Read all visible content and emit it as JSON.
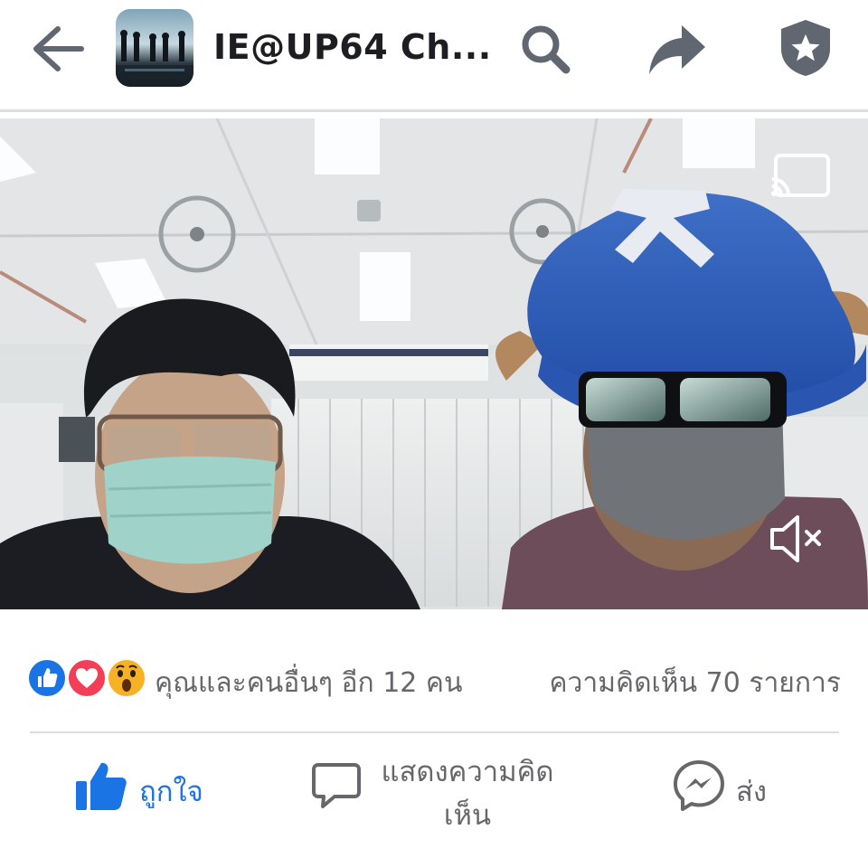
{
  "header": {
    "title": "IE@UP64 Ch...",
    "back_icon": "arrow-left-icon",
    "search_icon": "search-icon",
    "share_icon": "share-arrow-icon",
    "shield_icon": "shield-star-icon"
  },
  "video": {
    "cast_icon": "cast-icon",
    "mute_icon": "volume-muted-icon"
  },
  "reactions": {
    "icons": [
      "like-reaction-icon",
      "love-reaction-icon",
      "wow-reaction-icon"
    ],
    "summary": "คุณและคนอื่นๆ อีก 12 คน",
    "comments": "ความคิดเห็น 70 รายการ"
  },
  "actions": {
    "like": "ถูกใจ",
    "comment": "แสดงความคิดเห็น",
    "send": "ส่ง"
  },
  "colors": {
    "accent": "#1b74e4",
    "icon_gray": "#606770",
    "love": "#f33e58",
    "wow": "#f7b125"
  }
}
